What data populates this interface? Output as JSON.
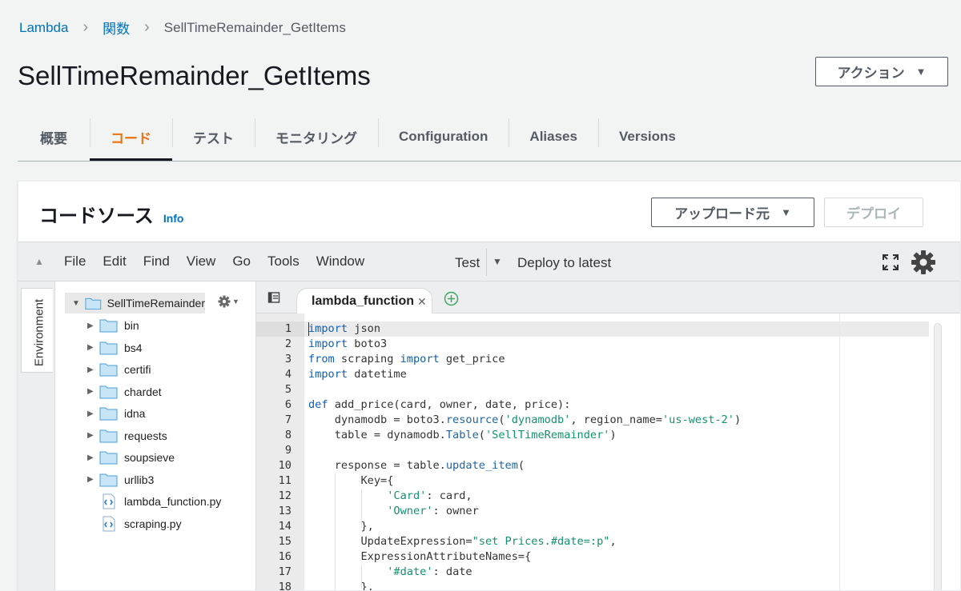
{
  "breadcrumb": {
    "items": [
      "Lambda",
      "関数",
      "SellTimeRemainder_GetItems"
    ]
  },
  "page": {
    "title": "SellTimeRemainder_GetItems",
    "action_button": "アクション"
  },
  "tabs": [
    "概要",
    "コード",
    "テスト",
    "モニタリング",
    "Configuration",
    "Aliases",
    "Versions"
  ],
  "active_tab": "コード",
  "code_source": {
    "title": "コードソース",
    "info_link": "Info",
    "upload_button": "アップロード元",
    "deploy_button": "デプロイ"
  },
  "ide": {
    "menu": [
      "File",
      "Edit",
      "Find",
      "View",
      "Go",
      "Tools",
      "Window"
    ],
    "test_button": "Test",
    "deploy_latest": "Deploy to latest",
    "environment_label": "Environment",
    "tree": {
      "root": "SellTimeRemainder_",
      "folders": [
        "bin",
        "bs4",
        "certifi",
        "chardet",
        "idna",
        "requests",
        "soupsieve",
        "urllib3"
      ],
      "files": [
        "lambda_function.py",
        "scraping.py"
      ]
    },
    "open_tab": "lambda_function",
    "line_numbers": [
      "1",
      "2",
      "3",
      "4",
      "5",
      "6",
      "7",
      "8",
      "9",
      "10",
      "11",
      "12",
      "13",
      "14",
      "15",
      "16",
      "17",
      "18"
    ]
  },
  "colors": {
    "accent": "#ec7211",
    "link": "#0073bb",
    "keyword": "#0d5fb8",
    "string": "#11946f"
  }
}
